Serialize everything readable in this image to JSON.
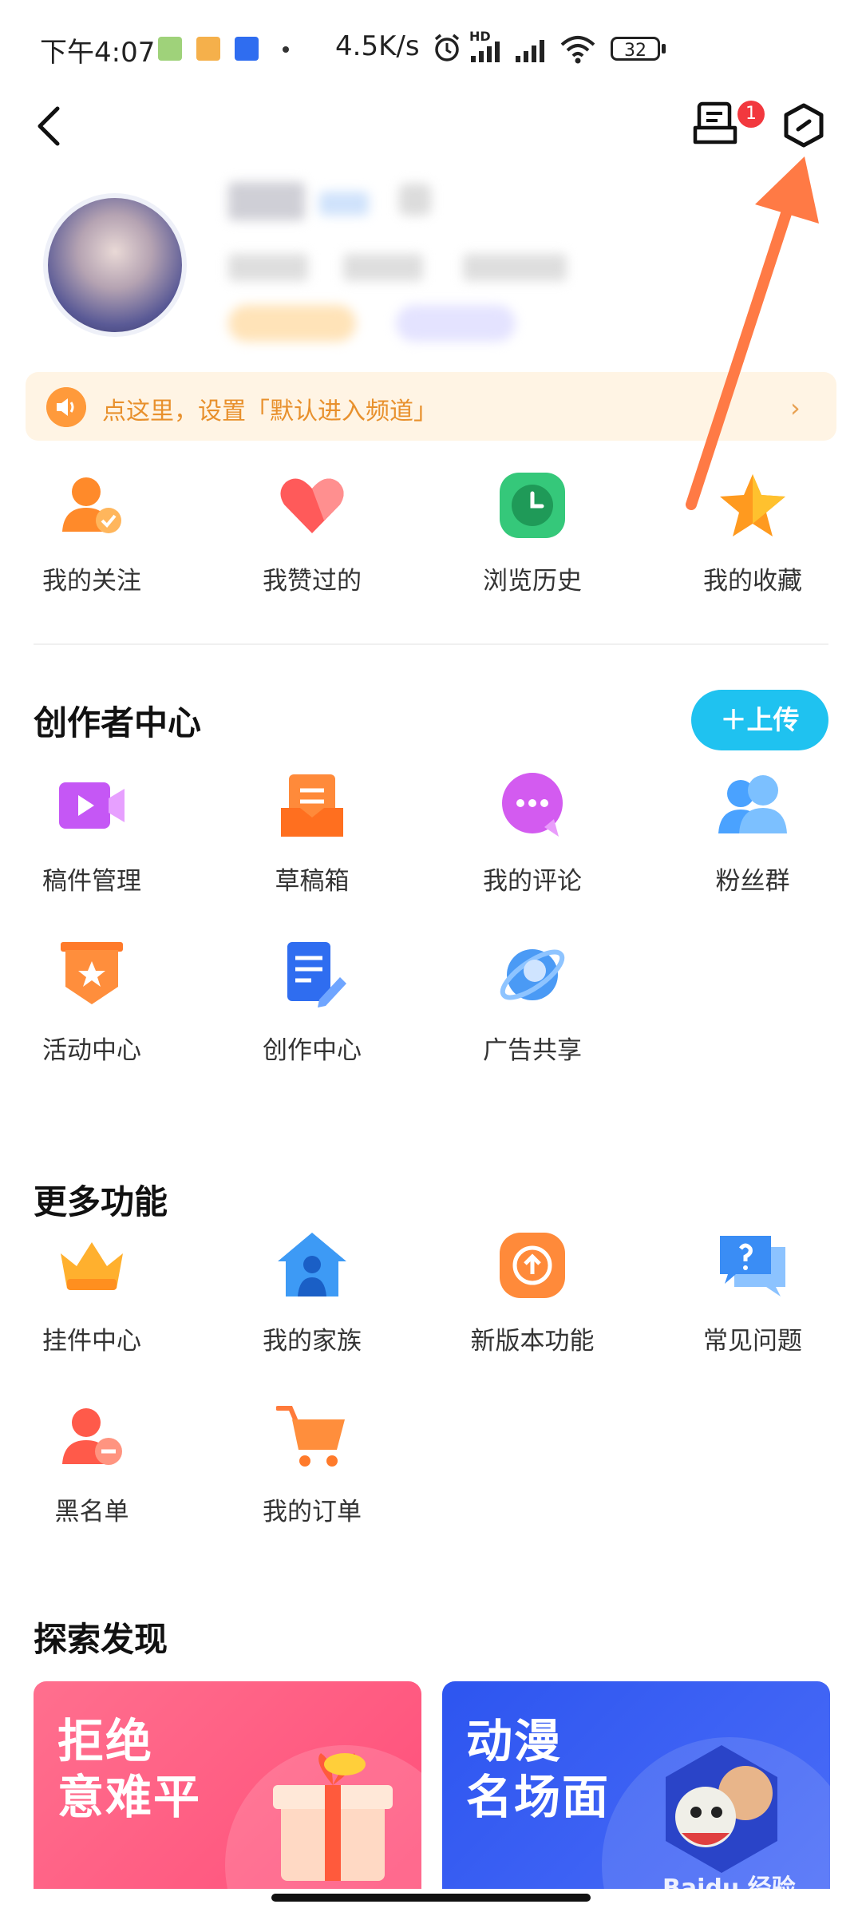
{
  "status_bar": {
    "time": "下午4:07",
    "network_speed": "4.5K/s",
    "hd_label": "HD",
    "battery": "32"
  },
  "header": {
    "message_badge": "1",
    "back_icon": "chevron-left-icon",
    "message_icon": "inbox-icon",
    "settings_icon": "hexagon-settings-icon"
  },
  "banner": {
    "text": "点这里，设置「默认进入频道」"
  },
  "quick_actions": [
    {
      "label": "我的关注",
      "icon": "user-check-icon"
    },
    {
      "label": "我赞过的",
      "icon": "heart-icon"
    },
    {
      "label": "浏览历史",
      "icon": "clock-icon"
    },
    {
      "label": "我的收藏",
      "icon": "star-icon"
    }
  ],
  "creator": {
    "title": "创作者中心",
    "upload_label": "上传",
    "items": [
      {
        "label": "稿件管理",
        "icon": "video-icon"
      },
      {
        "label": "草稿箱",
        "icon": "draft-box-icon"
      },
      {
        "label": "我的评论",
        "icon": "comment-icon"
      },
      {
        "label": "粉丝群",
        "icon": "fans-group-icon"
      },
      {
        "label": "活动中心",
        "icon": "activity-badge-icon"
      },
      {
        "label": "创作中心",
        "icon": "document-edit-icon"
      },
      {
        "label": "广告共享",
        "icon": "planet-icon"
      }
    ]
  },
  "more": {
    "title": "更多功能",
    "items": [
      {
        "label": "挂件中心",
        "icon": "crown-icon"
      },
      {
        "label": "我的家族",
        "icon": "family-house-icon"
      },
      {
        "label": "新版本功能",
        "icon": "upgrade-icon"
      },
      {
        "label": "常见问题",
        "icon": "question-chat-icon"
      },
      {
        "label": "黑名单",
        "icon": "user-block-icon"
      },
      {
        "label": "我的订单",
        "icon": "cart-icon"
      }
    ]
  },
  "explore": {
    "title": "探索发现",
    "cards": [
      {
        "line1": "拒绝",
        "line2": "意难平",
        "color": "#ff5c86"
      },
      {
        "line1": "动漫",
        "line2": "名场面",
        "color": "#3a5cf5"
      }
    ]
  },
  "watermark": "Baidu 经验",
  "colors": {
    "accent": "#1fc2f0",
    "arrow": "#ff7a45"
  }
}
